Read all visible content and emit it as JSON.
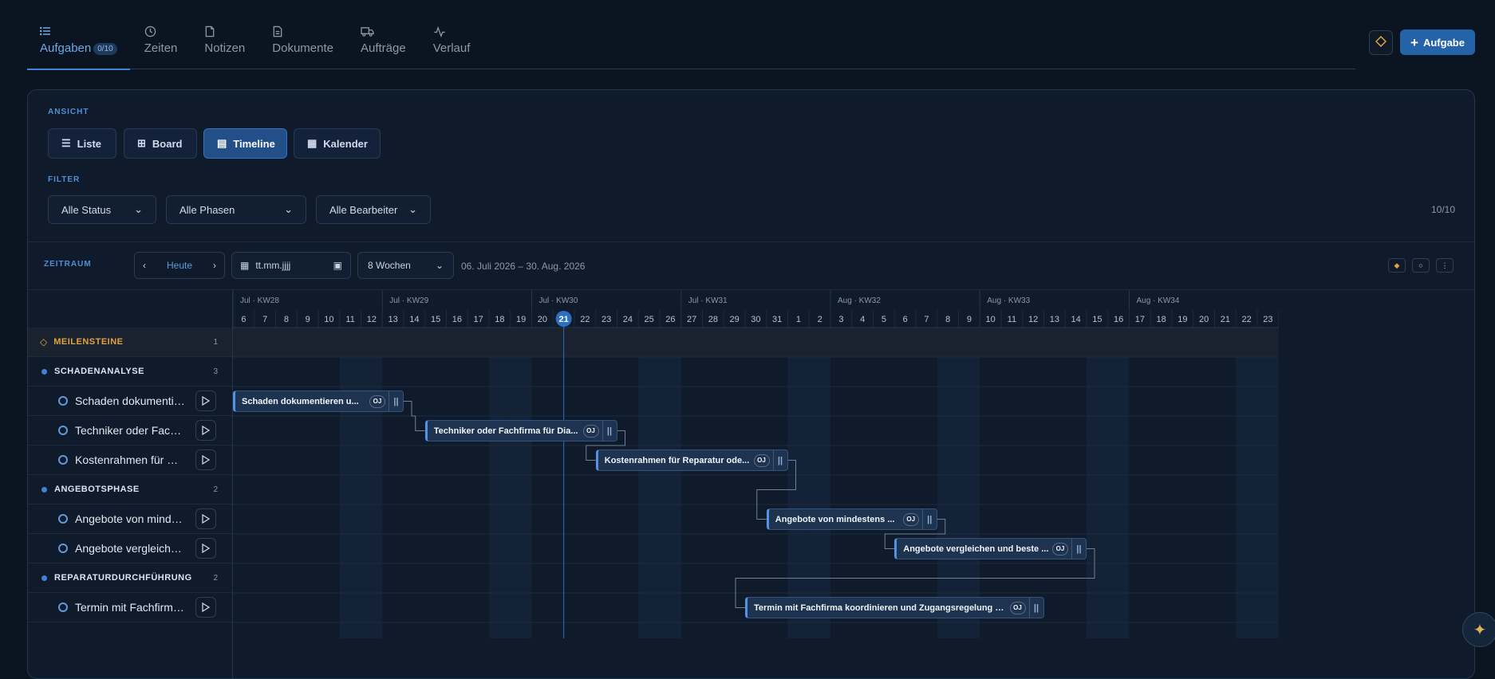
{
  "tabs": [
    {
      "label": "Aufgaben",
      "badge": "0/10",
      "icon": "list-icon"
    },
    {
      "label": "Zeiten",
      "icon": "clock-icon"
    },
    {
      "label": "Notizen",
      "icon": "note-icon"
    },
    {
      "label": "Dokumente",
      "icon": "document-icon"
    },
    {
      "label": "Aufträge",
      "icon": "truck-icon"
    },
    {
      "label": "Verlauf",
      "icon": "activity-icon"
    }
  ],
  "header": {
    "add_label": "Aufgabe"
  },
  "ansicht": {
    "label": "ANSICHT",
    "views": [
      "Liste",
      "Board",
      "Timeline",
      "Kalender"
    ],
    "active": "Timeline"
  },
  "filter": {
    "label": "FILTER",
    "status": "Alle Status",
    "phasen": "Alle Phasen",
    "bearbeiter": "Alle Bearbeiter",
    "count": "10/10"
  },
  "zeitraum": {
    "label": "ZEITRAUM",
    "today": "Heute",
    "date_placeholder": "tt.mm.jjjj",
    "weeks": "8 Wochen",
    "range": "06. Juli 2026 – 30. Aug. 2026"
  },
  "timeline": {
    "weeks": [
      "Jul · KW28",
      "Jul · KW29",
      "Jul · KW30",
      "Jul · KW31",
      "Aug · KW32",
      "Aug · KW33",
      "Aug · KW34"
    ],
    "days": [
      "6",
      "7",
      "8",
      "9",
      "10",
      "11",
      "12",
      "13",
      "14",
      "15",
      "16",
      "17",
      "18",
      "19",
      "20",
      "21",
      "22",
      "23",
      "24",
      "25",
      "26",
      "27",
      "28",
      "29",
      "30",
      "31",
      "1",
      "2",
      "3",
      "4",
      "5",
      "6",
      "7",
      "8",
      "9",
      "10",
      "11",
      "12",
      "13",
      "14",
      "15",
      "16",
      "17",
      "18",
      "19",
      "20",
      "21",
      "22",
      "23"
    ],
    "today_index": 15
  },
  "rows": [
    {
      "type": "milestone",
      "label": "MEILENSTEINE",
      "count": "1"
    },
    {
      "type": "group",
      "label": "SCHADENANALYSE",
      "count": "3"
    },
    {
      "type": "task",
      "label": "Schaden dokumentie...",
      "bar": "Schaden dokumentieren u...",
      "start": 0,
      "end": 7,
      "avatar": "OJ"
    },
    {
      "type": "task",
      "label": "Techniker oder Fachfi...",
      "bar": "Techniker oder Fachfirma für Dia...",
      "start": 9,
      "end": 17,
      "avatar": "OJ"
    },
    {
      "type": "task",
      "label": "Kostenrahmen für Re...",
      "bar": "Kostenrahmen für Reparatur ode...",
      "start": 17,
      "end": 25,
      "avatar": "OJ"
    },
    {
      "type": "group",
      "label": "ANGEBOTSPHASE",
      "count": "2"
    },
    {
      "type": "task",
      "label": "Angebote von mindes...",
      "bar": "Angebote von mindestens ...",
      "start": 25,
      "end": 32,
      "avatar": "OJ"
    },
    {
      "type": "task",
      "label": "Angebote vergleichen...",
      "bar": "Angebote vergleichen und beste ...",
      "start": 31,
      "end": 39,
      "avatar": "OJ"
    },
    {
      "type": "group",
      "label": "REPARATURDURCHFÜHRUNG",
      "count": "2"
    },
    {
      "type": "task",
      "label": "Termin mit Fachfirma ...",
      "bar": "Termin mit Fachfirma koordinieren und Zugangsregelung klären",
      "start": 24,
      "end": 37,
      "avatar": "OJ"
    }
  ]
}
